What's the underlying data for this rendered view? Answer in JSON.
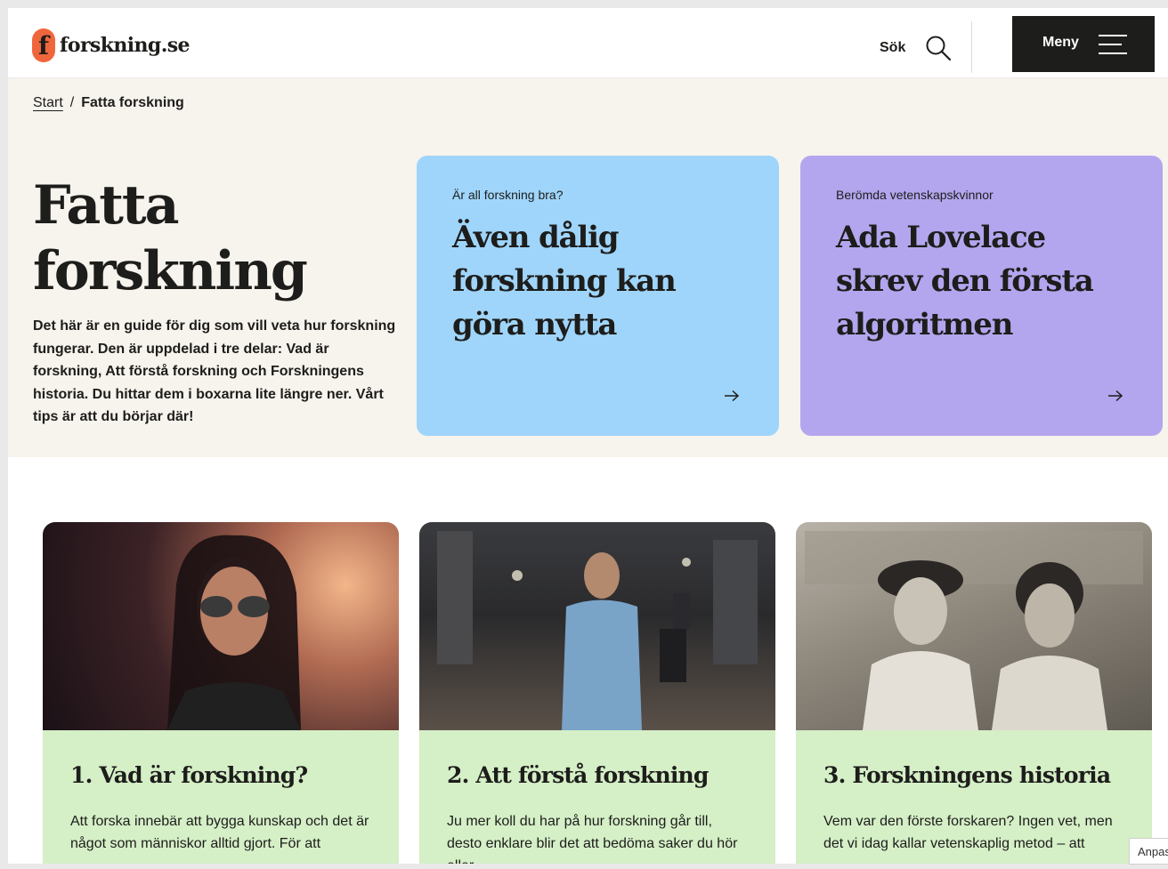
{
  "header": {
    "logo_mark": "f",
    "logo_text": "forskning.se",
    "search_label": "Sök",
    "menu_label": "Meny"
  },
  "breadcrumb": {
    "home": "Start",
    "separator": "/",
    "current": "Fatta forskning"
  },
  "hero": {
    "title": "Fatta forskning",
    "intro": "Det här är en guide för dig som vill veta hur forskning fungerar. Den är uppdelad i tre delar: Vad är forskning, Att förstå forskning och Forskningens historia. Du hittar dem i boxarna lite längre ner. Vårt tips är att du börjar där!"
  },
  "feature_cards": [
    {
      "kicker": "Är all forskning bra?",
      "heading": "Även dålig forskning kan göra nytta",
      "color": "#9fd5fb"
    },
    {
      "kicker": "Berömda vetenskapskvinnor",
      "heading": "Ada Lovelace skrev den första algoritmen",
      "color": "#b3a6ee"
    }
  ],
  "sections": [
    {
      "title": "1. Vad är forskning?",
      "text": "Att forska innebär att bygga kunskap och det är något som människor alltid gjort. För att"
    },
    {
      "title": "2. Att förstå forskning",
      "text": "Ju mer koll du har på hur forskning går till, desto enklare blir det att bedöma saker du hör eller"
    },
    {
      "title": "3. Forskningens historia",
      "text": "Vem var den förste forskaren? Ingen vet, men det vi idag kallar vetenskaplig metod – att"
    }
  ],
  "cookie_tab": "Anpas",
  "colors": {
    "accent_orange": "#f0663c",
    "hero_bg": "#f7f3ed",
    "section_green": "#d5efc7",
    "dark": "#1d1d1b"
  }
}
